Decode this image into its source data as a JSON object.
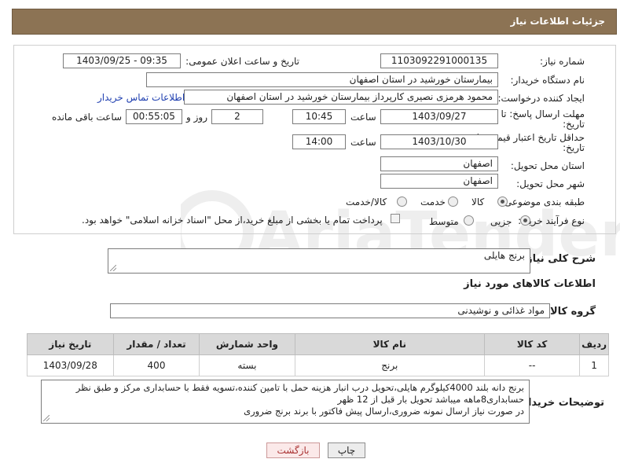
{
  "header": {
    "title": "جزئیات اطلاعات نیاز"
  },
  "fields": {
    "need_number_label": "شماره نیاز:",
    "need_number": "1103092291000135",
    "announce_label": "تاریخ و ساعت اعلان عمومی:",
    "announce_value": "1403/09/25 - 09:35",
    "buyer_org_label": "نام دستگاه خریدار:",
    "buyer_org": "بیمارستان خورشید در استان اصفهان",
    "creator_label": "ایجاد کننده درخواست:",
    "creator": "محمود هرمزی نصیری کارپرداز بیمارستان خورشید در استان اصفهان",
    "contact_link": "اطلاعات تماس خریدار",
    "reply_deadline_label_1": "مهلت ارسال پاسخ: تا",
    "reply_deadline_label_2": "تاریخ:",
    "reply_date": "1403/09/27",
    "time_label": "ساعت",
    "reply_time": "10:45",
    "days": "2",
    "days_label": "روز و",
    "remaining": "00:55:05",
    "remaining_label": "ساعت باقی مانده",
    "price_validity_label_1": "حداقل تاریخ اعتبار قیمت: تا",
    "price_validity_label_2": "تاریخ:",
    "price_date": "1403/10/30",
    "price_time": "14:00",
    "province_label": "استان محل تحویل:",
    "province": "اصفهان",
    "city_label": "شهر محل تحویل:",
    "city": "اصفهان",
    "category_label": "طبقه بندی موضوعی:",
    "category_options": [
      "کالا",
      "خدمت",
      "کالا/خدمت"
    ],
    "process_label": "نوع فرآیند خرید :",
    "process_options": [
      "جزیی",
      "متوسط"
    ],
    "payment_note": "پرداخت تمام یا بخشی از مبلغ خرید،از محل \"اسناد خزانه اسلامی\" خواهد بود."
  },
  "summary": {
    "label": "شرح کلی نیاز:",
    "value": "برنج هایلی"
  },
  "goods": {
    "section_title": "اطلاعات کالاهای مورد نیاز",
    "group_label": "گروه کالا:",
    "group_value": "مواد غذائی و نوشیدنی",
    "columns": [
      "ردیف",
      "کد کالا",
      "نام کالا",
      "واحد شمارش",
      "تعداد / مقدار",
      "تاریخ نیاز"
    ],
    "rows": [
      {
        "index": "1",
        "code": "--",
        "name": "برنج",
        "unit": "بسته",
        "qty": "400",
        "date": "1403/09/28"
      }
    ]
  },
  "buyer_notes": {
    "label": "توضیحات خریدار:",
    "line1": "برنج دانه بلند 4000کیلوگرم هایلی،تحویل درب انبار هزینه حمل با تامین کننده،تسویه فقط با حسابداری مرکز و طبق نظر",
    "line2": "حسابداری8ماهه میباشد تحویل بار قبل از 12 ظهر",
    "line3": "در صورت نیاز ارسال نمونه ضروری،ارسال پیش فاکتور با برند برنج ضروری"
  },
  "buttons": {
    "print": "چاپ",
    "back": "بازگشت"
  },
  "watermark": {
    "text": "AriaTender.neT"
  },
  "colors": {
    "header_bg": "#8c7354",
    "link": "#1f3fb0",
    "back_button": "#a33"
  }
}
